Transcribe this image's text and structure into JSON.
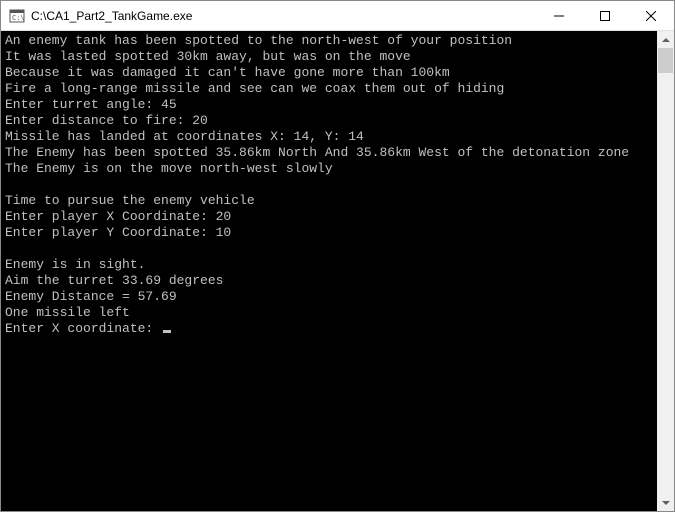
{
  "window": {
    "title": "C:\\CA1_Part2_TankGame.exe"
  },
  "console": {
    "lines": [
      "An enemy tank has been spotted to the north-west of your position",
      "It was lasted spotted 30km away, but was on the move",
      "Because it was damaged it can't have gone more than 100km",
      "Fire a long-range missile and see can we coax them out of hiding",
      "Enter turret angle: 45",
      "Enter distance to fire: 20",
      "Missile has landed at coordinates X: 14, Y: 14",
      "The Enemy has been spotted 35.86km North And 35.86km West of the detonation zone",
      "The Enemy is on the move north-west slowly",
      "",
      "Time to pursue the enemy vehicle",
      "Enter player X Coordinate: 20",
      "Enter player Y Coordinate: 10",
      "",
      "Enemy is in sight.",
      "Aim the turret 33.69 degrees",
      "Enemy Distance = 57.69",
      "One missile left",
      "Enter X coordinate: "
    ]
  }
}
